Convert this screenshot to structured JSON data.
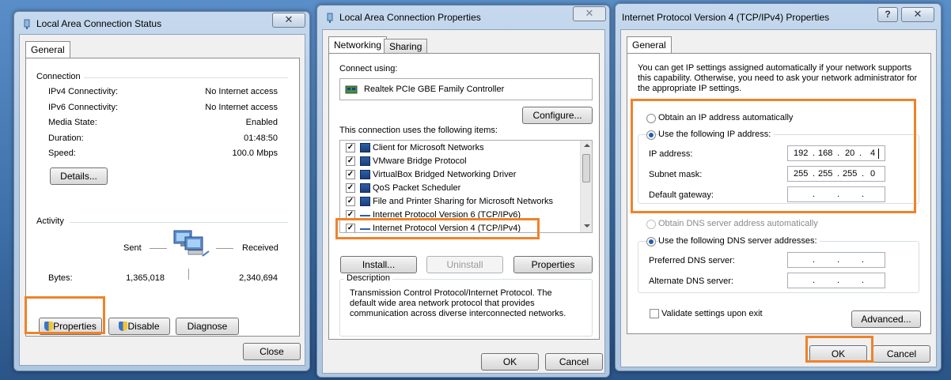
{
  "status_window": {
    "title": "Local Area Connection Status",
    "tab": "General",
    "connection_heading": "Connection",
    "rows": [
      {
        "label": "IPv4 Connectivity:",
        "value": "No Internet access"
      },
      {
        "label": "IPv6 Connectivity:",
        "value": "No Internet access"
      },
      {
        "label": "Media State:",
        "value": "Enabled"
      },
      {
        "label": "Duration:",
        "value": "01:48:50"
      },
      {
        "label": "Speed:",
        "value": "100.0 Mbps"
      }
    ],
    "details_button": "Details...",
    "activity_heading": "Activity",
    "sent_label": "Sent",
    "received_label": "Received",
    "bytes_label": "Bytes:",
    "bytes_sent": "1,365,018",
    "bytes_received": "2,340,694",
    "properties_button": "Properties",
    "disable_button": "Disable",
    "diagnose_button": "Diagnose",
    "close_button": "Close"
  },
  "properties_window": {
    "title": "Local Area Connection Properties",
    "tabs": [
      "Networking",
      "Sharing"
    ],
    "connect_using_label": "Connect using:",
    "adapter_name": "Realtek PCIe GBE Family Controller",
    "configure_button": "Configure...",
    "items_label": "This connection uses the following items:",
    "items": [
      {
        "label": "Client for Microsoft Networks",
        "checked": true
      },
      {
        "label": "VMware Bridge Protocol",
        "checked": true
      },
      {
        "label": "VirtualBox Bridged Networking Driver",
        "checked": true
      },
      {
        "label": "QoS Packet Scheduler",
        "checked": true
      },
      {
        "label": "File and Printer Sharing for Microsoft Networks",
        "checked": true
      },
      {
        "label": "Internet Protocol Version 6 (TCP/IPv6)",
        "checked": true
      },
      {
        "label": "Internet Protocol Version 4 (TCP/IPv4)",
        "checked": true
      }
    ],
    "install_button": "Install...",
    "uninstall_button": "Uninstall",
    "properties_button": "Properties",
    "description_heading": "Description",
    "description_text": "Transmission Control Protocol/Internet Protocol. The default wide area network protocol that provides communication across diverse interconnected networks.",
    "ok_button": "OK",
    "cancel_button": "Cancel"
  },
  "ipv4_window": {
    "title": "Internet Protocol Version 4 (TCP/IPv4) Properties",
    "help_glyph": "?",
    "tab": "General",
    "intro_text": "You can get IP settings assigned automatically if your network supports this capability. Otherwise, you need to ask your network administrator for the appropriate IP settings.",
    "obtain_ip_auto": "Obtain an IP address automatically",
    "use_following_ip": "Use the following IP address:",
    "ip_label": "IP address:",
    "ip_value": [
      "192",
      "168",
      "20",
      "4"
    ],
    "subnet_label": "Subnet mask:",
    "subnet_value": [
      "255",
      "255",
      "255",
      "0"
    ],
    "gateway_label": "Default gateway:",
    "obtain_dns_auto": "Obtain DNS server address automatically",
    "use_following_dns": "Use the following DNS server addresses:",
    "preferred_dns_label": "Preferred DNS server:",
    "alternate_dns_label": "Alternate DNS server:",
    "validate_label": "Validate settings upon exit",
    "advanced_button": "Advanced...",
    "ok_button": "OK",
    "cancel_button": "Cancel"
  },
  "close_glyph": "✕",
  "accent_color": "#f0822a"
}
